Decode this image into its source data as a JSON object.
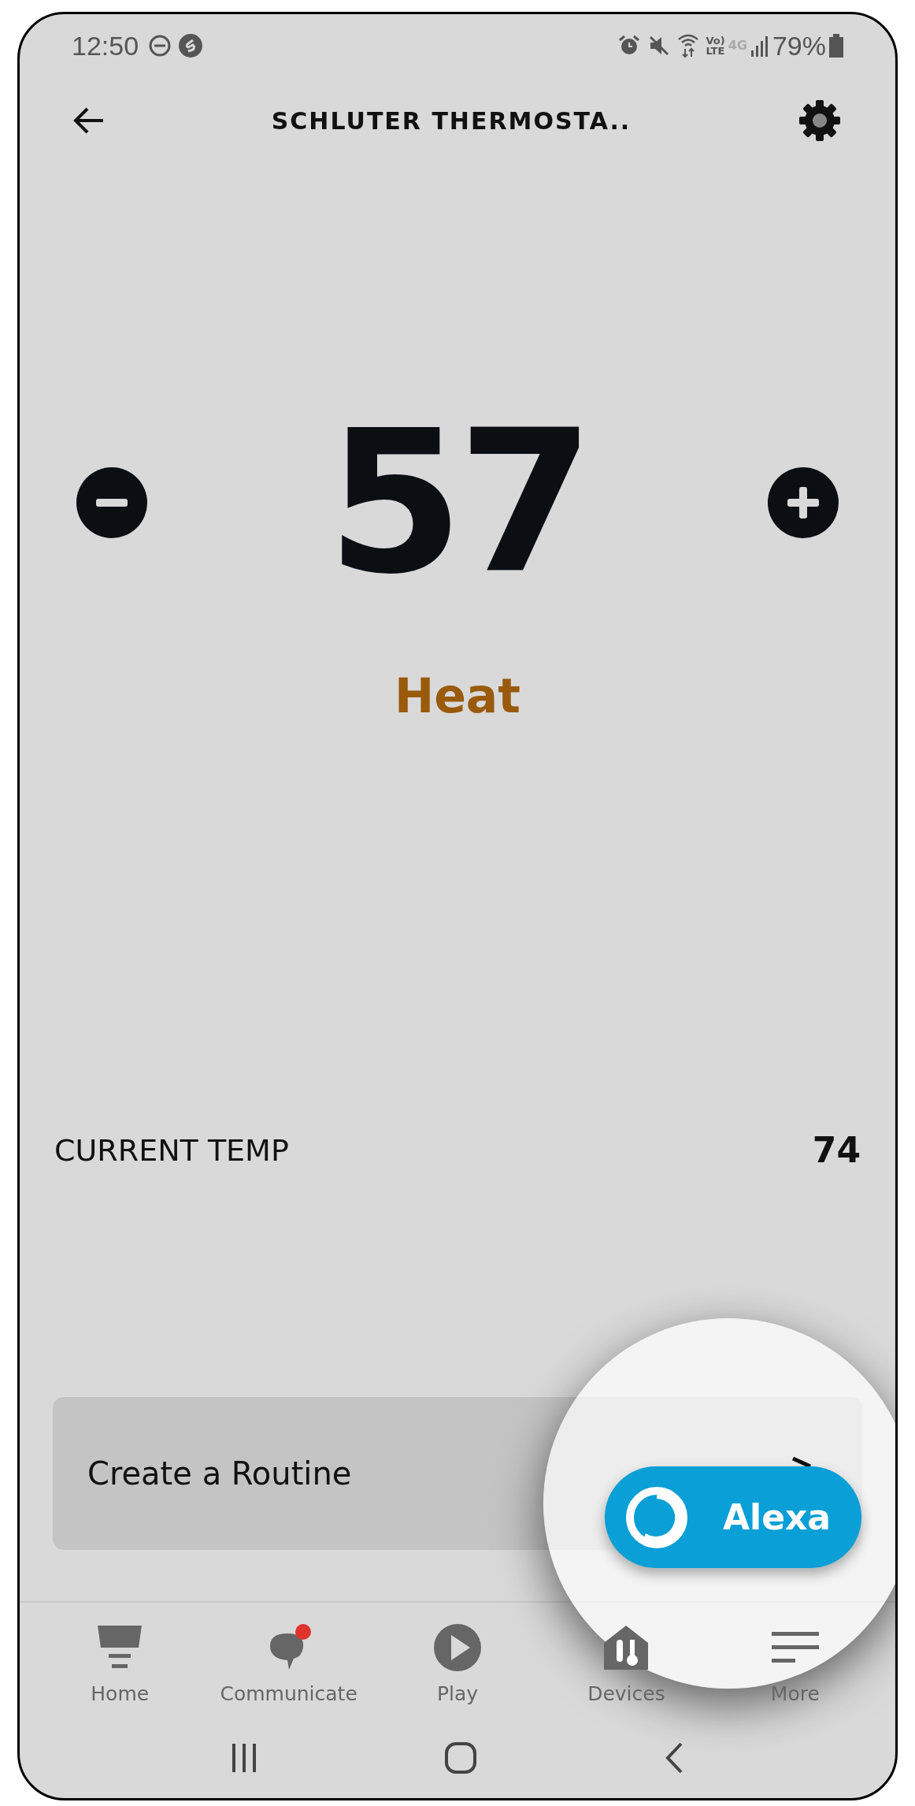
{
  "status_bar": {
    "time": "12:50",
    "volte": [
      "Vo)",
      "LTE"
    ],
    "network": "4G",
    "battery": "79%"
  },
  "header": {
    "title": "SCHLUTER THERMOSTA.."
  },
  "thermostat": {
    "setpoint": "57",
    "mode": "Heat"
  },
  "current_temp": {
    "label": "CURRENT TEMP",
    "value": "74"
  },
  "routine_card": {
    "label": "Create a Routine"
  },
  "alexa_button": {
    "label": "Alexa"
  },
  "bottom_nav": [
    {
      "kind": "home",
      "label": "Home",
      "badge": false
    },
    {
      "kind": "communicate",
      "label": "Communicate",
      "badge": true
    },
    {
      "kind": "play",
      "label": "Play",
      "badge": false
    },
    {
      "kind": "devices",
      "label": "Devices",
      "badge": false
    },
    {
      "kind": "more",
      "label": "More",
      "badge": false
    }
  ]
}
